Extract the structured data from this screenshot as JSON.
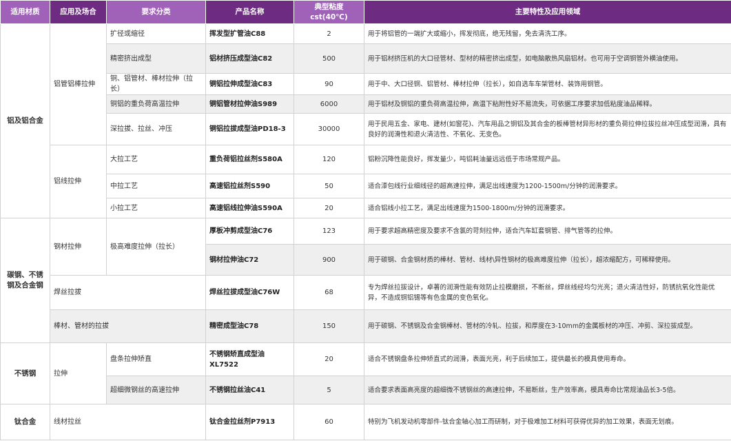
{
  "headers": {
    "material": "适用材质",
    "application": "应用及场合",
    "requirement": "要求分类",
    "product": "产品名称",
    "viscosity": "典型粘度cst(40℃)",
    "features": "主要特性及应用领域"
  },
  "groups": {
    "aluminum": "铝及铝合金",
    "carbon_steel": "碳钢、不锈钢及合金钢",
    "stainless": "不锈钢",
    "titanium": "钛合金"
  },
  "applications": {
    "al_tube_rod": "铝管铝棒拉伸",
    "al_wire": "铝线拉伸",
    "steel_drawing": "钢材拉伸",
    "weld_wire": "焊丝拉拔",
    "bar_tube": "棒材、管材的拉拔",
    "ss_drawing": "拉伸",
    "ti_wire": "线材拉丝"
  },
  "requirements": {
    "r1": "扩径或缩径",
    "r2": "精密挤出成型",
    "r3": "铜、铝管材、棒材拉伸（拉长）",
    "r4": "铜铝的重负荷高温拉伸",
    "r5": "深拉拔、拉丝、冲压",
    "r6": "大拉工艺",
    "r7": "中拉工艺",
    "r8": "小拉工艺",
    "r9": "极高难度拉伸（拉长）",
    "r10": "盘条拉伸矫直",
    "r11": "超细微钢丝的高速拉伸"
  },
  "rows": [
    {
      "name": "挥发型扩管油C88",
      "vis": "2",
      "desc": "用于将铝管的一端扩大或缩小，挥发彻底，绝无残留，免去清洗工序。"
    },
    {
      "name": "铝材挤压成型油C82",
      "vis": "500",
      "desc": "用于铝材挤压机的大口径管材、型材的精密挤出成型，如电脑散热风扇铝材。也可用于空调铜管外横油使用。"
    },
    {
      "name": "铜铝拉伸成型油C83",
      "vis": "90",
      "desc": "用于中、大口径铜、铝管材、棒材拉伸（拉长），如自选车车架管材、装饰用铜管。"
    },
    {
      "name": "铜铝管材拉伸油S989",
      "vis": "6000",
      "desc": "用于铝材及铜铝的重负荷高温拉伸，高温下粘附性好不易流失，可依据工序要求加低粘度油品稀释。"
    },
    {
      "name": "铜铝拉拔成型油PD18-3",
      "vis": "30000",
      "desc": "用于民用五金、家电、建材(如窗花)、汽车用品之铜铝及其合金的板棒管材异形材的重负荷拉伸拉拔拉丝冲压成型润滑，具有良好的润滑性和退火清洁性、不氧化、无变色。"
    },
    {
      "name": "重负荷铝拉丝剂S580A",
      "vis": "120",
      "desc": "铝粉沉降性能良好，挥发量少，吨铝耗油量远远低于市场常规产品。"
    },
    {
      "name": "高速铝拉丝剂S590",
      "vis": "50",
      "desc": "适合漆包线行业细线径的超高速拉伸，满足出线速度为1200-1500m/分钟的润滑要求。"
    },
    {
      "name": "高速铝线拉伸油S590A",
      "vis": "20",
      "desc": "适合铝线小拉工艺，满足出线速度为1500-1800m/分钟的润滑要求。"
    },
    {
      "name": "厚板冲剪成型油C76",
      "vis": "123",
      "desc": "用于要求超高精密度及要求不含氯的苛刻拉伸，适合汽车缸套钢管、排气管等的拉伸。"
    },
    {
      "name": "钢材拉伸油C72",
      "vis": "900",
      "desc": "用于碳钢、合金钢材质的棒材、管材、线材\\异性钢材的极高难度拉伸（拉长），超浓缩配方，可稀释使用。"
    },
    {
      "name": "焊丝拉拔成型油C76W",
      "vis": "68",
      "desc": "专为焊丝拉拔设计，卓著的润滑性能有效防止拉模磨损，不断丝，焊丝线经均匀光亮；退火清洁性好，防锈抗氧化性能优异，不造成铜铝锡等有色金属的变色氧化。"
    },
    {
      "name": "精密成型油C78",
      "vis": "150",
      "desc": "用于碳钢、不锈钢及合金钢棒材、管材的冷轧、拉拔，和厚度在3-10mm的金属板材的冲压、冲剪、深拉拔成型。"
    },
    {
      "name": "不锈钢矫直成型油XL7522",
      "vis": "20",
      "desc": "适合不锈钢盘条拉伸矫直式的润滑，表面光亮，利于后续加工，提供最长的模具使用寿命。"
    },
    {
      "name": "不锈钢拉丝油C41",
      "vis": "5",
      "desc": "适合要求表面高亮度的超细微不锈钢丝的高速拉伸，不易断丝，生产效率高，模具寿命比常规油品长3-5倍。"
    },
    {
      "name": "钛合金拉丝剂P7913",
      "vis": "60",
      "desc": "特别为飞机发动机零部件-钛合金轴心加工而研制，对于极难加工材料可获得优异的加工效果，表面无划痕。"
    }
  ],
  "colors": {
    "header_dark": "#6e2b82",
    "header_light": "#a062b8",
    "row_shade": "#efeff0",
    "border": "#d2d2d2"
  }
}
